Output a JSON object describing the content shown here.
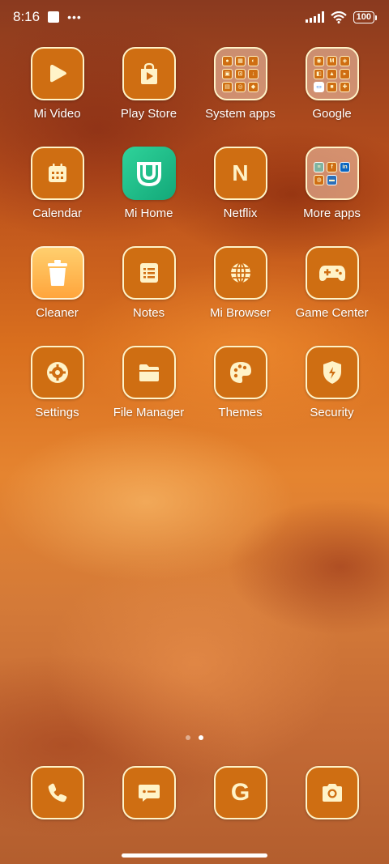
{
  "status": {
    "time": "8:16",
    "dots": "•••",
    "battery": "100"
  },
  "apps": [
    {
      "label": "Mi Video",
      "icon": "play-icon"
    },
    {
      "label": "Play Store",
      "icon": "play-store-icon"
    },
    {
      "label": "System apps",
      "icon": "folder-icon"
    },
    {
      "label": "Google",
      "icon": "folder-icon"
    },
    {
      "label": "Calendar",
      "icon": "calendar-icon"
    },
    {
      "label": "Mi Home",
      "icon": "mi-home-icon"
    },
    {
      "label": "Netflix",
      "icon": "netflix-icon",
      "glyph": "N"
    },
    {
      "label": "More apps",
      "icon": "folder-icon",
      "minis": [
        "f",
        "in"
      ]
    },
    {
      "label": "Cleaner",
      "icon": "trash-icon"
    },
    {
      "label": "Notes",
      "icon": "notes-icon"
    },
    {
      "label": "Mi Browser",
      "icon": "globe-icon"
    },
    {
      "label": "Game Center",
      "icon": "gamepad-icon"
    },
    {
      "label": "Settings",
      "icon": "gear-icon"
    },
    {
      "label": "File Manager",
      "icon": "folder-files-icon"
    },
    {
      "label": "Themes",
      "icon": "palette-icon"
    },
    {
      "label": "Security",
      "icon": "shield-icon"
    }
  ],
  "dock": [
    {
      "name": "phone",
      "icon": "phone-icon"
    },
    {
      "name": "messages",
      "icon": "message-icon"
    },
    {
      "name": "google",
      "icon": "google-icon",
      "glyph": "G"
    },
    {
      "name": "camera",
      "icon": "camera-icon"
    }
  ],
  "colors": {
    "accent": "#cf6e12",
    "border": "#fff3c8"
  }
}
